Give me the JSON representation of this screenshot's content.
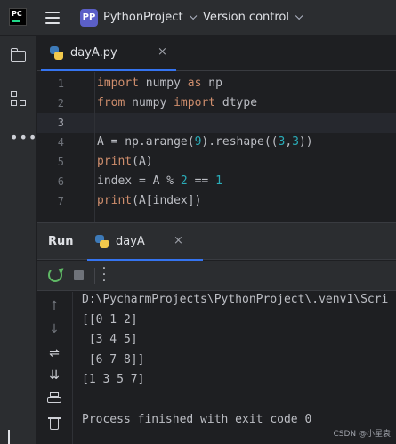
{
  "titlebar": {
    "logo_text": "PC",
    "project_badge": "PP",
    "project_name": "PythonProject",
    "vcs_label": "Version control"
  },
  "editor": {
    "tab_name": "dayA.py",
    "tab_close": "×",
    "lines": [
      {
        "n": "1",
        "tokens": [
          {
            "t": "import",
            "c": "kw"
          },
          {
            "t": " numpy ",
            "c": ""
          },
          {
            "t": "as",
            "c": "kw"
          },
          {
            "t": " np",
            "c": ""
          }
        ]
      },
      {
        "n": "2",
        "tokens": [
          {
            "t": "from",
            "c": "kw"
          },
          {
            "t": " numpy ",
            "c": ""
          },
          {
            "t": "import",
            "c": "kw"
          },
          {
            "t": " dtype",
            "c": ""
          }
        ]
      },
      {
        "n": "3",
        "tokens": []
      },
      {
        "n": "4",
        "tokens": [
          {
            "t": "A = np.arange(",
            "c": ""
          },
          {
            "t": "9",
            "c": "num"
          },
          {
            "t": ").reshape((",
            "c": ""
          },
          {
            "t": "3",
            "c": "num"
          },
          {
            "t": ",",
            "c": ""
          },
          {
            "t": "3",
            "c": "num"
          },
          {
            "t": "))",
            "c": ""
          }
        ]
      },
      {
        "n": "5",
        "tokens": [
          {
            "t": "print",
            "c": "kw"
          },
          {
            "t": "(A)",
            "c": ""
          }
        ]
      },
      {
        "n": "6",
        "tokens": [
          {
            "t": "index = A % ",
            "c": ""
          },
          {
            "t": "2",
            "c": "num"
          },
          {
            "t": " == ",
            "c": ""
          },
          {
            "t": "1",
            "c": "num"
          }
        ]
      },
      {
        "n": "7",
        "tokens": [
          {
            "t": "print",
            "c": "kw"
          },
          {
            "t": "(A[index])",
            "c": ""
          }
        ]
      }
    ],
    "current_line": "3"
  },
  "run": {
    "title": "Run",
    "tab_name": "dayA",
    "tab_close": "×",
    "output": [
      "D:\\PycharmProjects\\PythonProject\\.venv1\\Scri",
      "[[0 1 2]",
      " [3 4 5]",
      " [6 7 8]]",
      "[1 3 5 7]",
      "",
      "Process finished with exit code 0"
    ]
  },
  "watermark": "CSDN @小星袁",
  "colors": {
    "keyword": "#cf8e6d",
    "number": "#2aacb8",
    "accent": "#3574f0",
    "rerun": "#5fb865"
  }
}
